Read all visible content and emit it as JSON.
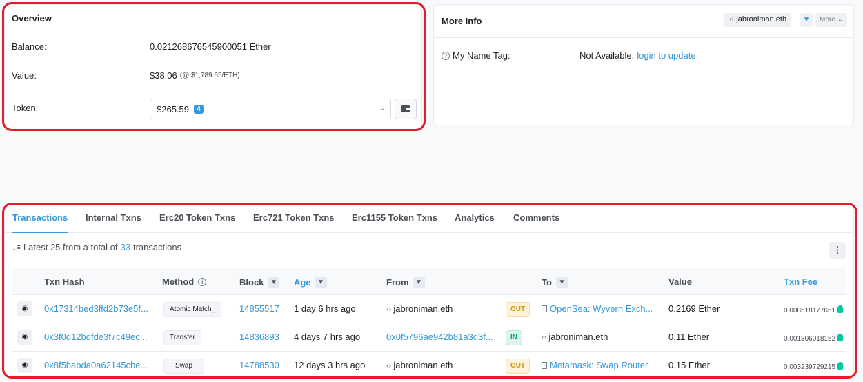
{
  "overview": {
    "title": "Overview",
    "balance_label": "Balance:",
    "balance_value": "0.021268676545900051 Ether",
    "value_label": "Value:",
    "value_usd": "$38.06",
    "value_rate": "(@ $1,789.65/ETH)",
    "token_label": "Token:",
    "token_value": "$265.59",
    "token_count": "4"
  },
  "more_info": {
    "title": "More Info",
    "ens_name": "jabroniman.eth",
    "more_label": "More",
    "name_tag_label": "My Name Tag:",
    "name_tag_value": "Not Available,",
    "name_tag_link": "login to update"
  },
  "tabs": [
    "Transactions",
    "Internal Txns",
    "Erc20 Token Txns",
    "Erc721 Token Txns",
    "Erc1155 Token Txns",
    "Analytics",
    "Comments"
  ],
  "summary": {
    "prefix": "Latest 25 from a total of",
    "count": "33",
    "suffix": "transactions"
  },
  "columns": {
    "hash": "Txn Hash",
    "method": "Method",
    "block": "Block",
    "age": "Age",
    "from": "From",
    "to": "To",
    "value": "Value",
    "fee": "Txn Fee"
  },
  "rows": [
    {
      "hash": "0x17314bed3ffd2b73e5f...",
      "method": "Atomic Match_",
      "block": "14855517",
      "age": "1 day 6 hrs ago",
      "from": "jabroniman.eth",
      "dir": "OUT",
      "to": "OpenSea: Wyvern Exch...",
      "value": "0.2169 Ether",
      "fee": "0.008518177651"
    },
    {
      "hash": "0x3f0d12bdfde3f7c49ec...",
      "method": "Transfer",
      "block": "14836893",
      "age": "4 days 7 hrs ago",
      "from": "0x0f5796ae942b81a3d3f...",
      "dir": "IN",
      "to": "jabroniman.eth",
      "value": "0.11 Ether",
      "fee": "0.001306018152"
    },
    {
      "hash": "0x8f5babda0a62145cbe...",
      "method": "Swap",
      "block": "14788530",
      "age": "12 days 3 hrs ago",
      "from": "jabroniman.eth",
      "dir": "OUT",
      "to": "Metamask: Swap Router",
      "value": "0.15 Ether",
      "fee": "0.003239729215"
    }
  ],
  "colors": {
    "accent": "#3498db",
    "annotation_red": "#e11d2b"
  }
}
